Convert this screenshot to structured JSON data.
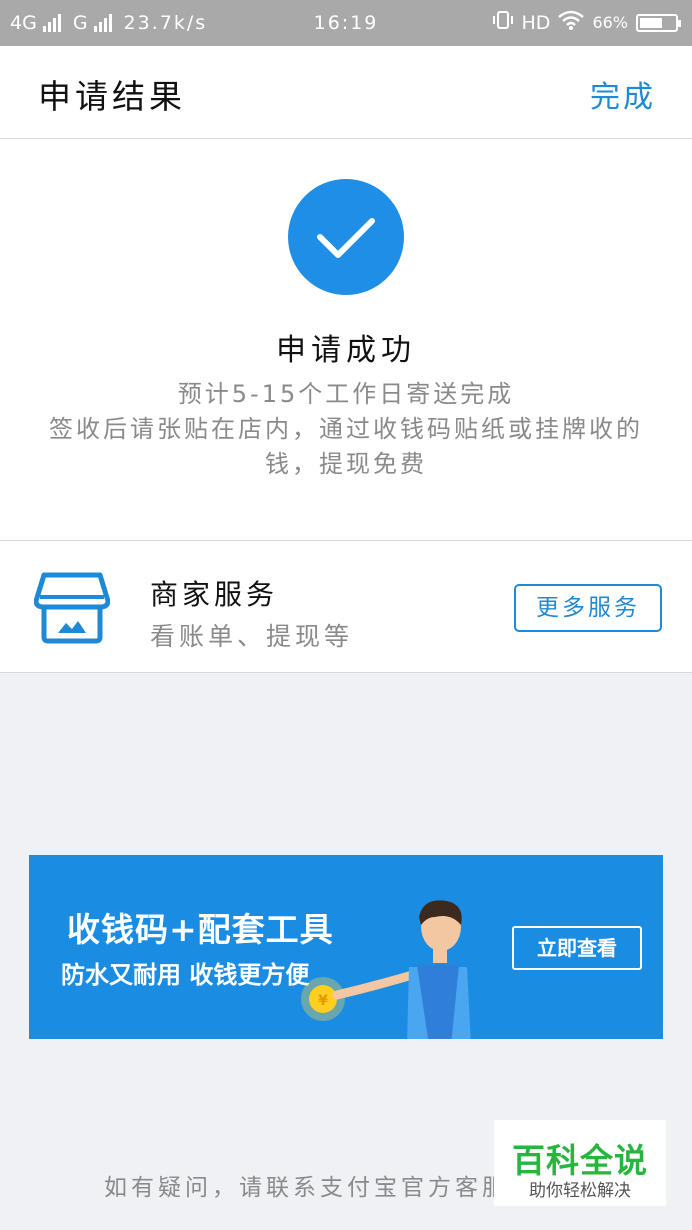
{
  "status_bar": {
    "network_1": "4G",
    "network_2": "G",
    "speed": "23.7k/s",
    "time": "16:19",
    "hd": "HD",
    "battery": "66%",
    "battery_level": 0.66
  },
  "nav": {
    "title": "申请结果",
    "done_label": "完成"
  },
  "result": {
    "title": "申请成功",
    "line1": "预计5-15个工作日寄送完成",
    "line2": "签收后请张贴在店内，通过收钱码贴纸或挂牌收的钱，提现免费"
  },
  "service": {
    "name": "商家服务",
    "subtitle": "看账单、提现等",
    "button_label": "更多服务"
  },
  "banner": {
    "title": "收钱码+配套工具",
    "subtitle": "防水又耐用 收钱更方便",
    "button_label": "立即查看",
    "coin_symbol": "¥"
  },
  "footer": {
    "text": "如有疑问，请联系支付宝官方客服"
  },
  "watermark": {
    "main": "百科全说",
    "sub": "助你轻松解决"
  },
  "colors": {
    "accent": "#1e8ad6",
    "check_bg": "#1e8ee6",
    "banner_bg": "#1a8de3",
    "watermark_green": "#27b53e"
  }
}
